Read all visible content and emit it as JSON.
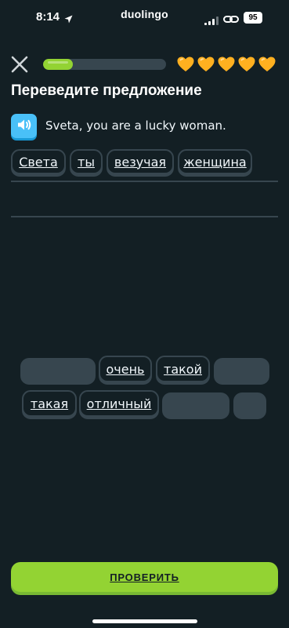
{
  "status_bar": {
    "time": "8:14",
    "brand": "duolingo",
    "battery": "95"
  },
  "lesson": {
    "progress": 0.24,
    "hearts": 5
  },
  "page_title": "Переведите предложение",
  "prompt": "Sveta, you are a lucky woman.",
  "answer_words": [
    "Света",
    "ты",
    "везучая",
    "женщина"
  ],
  "bank_words": [
    "очень",
    "такой",
    "такая",
    "отличный"
  ],
  "check_button": "ПРОВЕРИТЬ",
  "colors": {
    "background": "#131f24",
    "progress_green": "#93d333",
    "heart": "#ffb020",
    "speaker_blue": "#49c0f8",
    "chip_border": "#37464f"
  }
}
